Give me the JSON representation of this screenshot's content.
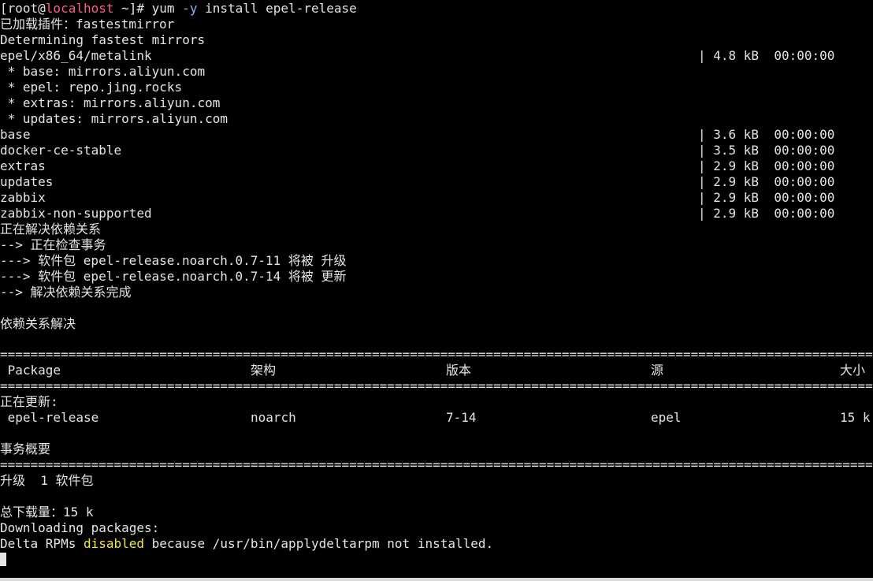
{
  "prompt": {
    "user": "[root@",
    "host": "localhost",
    "rest": " ~]# yum ",
    "flag": "-y",
    "command": " install epel-release"
  },
  "lines": {
    "l1": "已加载插件：fastestmirror",
    "l2": "Determining fastest mirrors",
    "l3": "epel/x86_64/metalink",
    "l3_right": "| 4.8 kB  00:00:00",
    "l4": " * base: mirrors.aliyun.com",
    "l5": " * epel: repo.jing.rocks",
    "l6": " * extras: mirrors.aliyun.com",
    "l7": " * updates: mirrors.aliyun.com"
  },
  "repos": [
    {
      "name": "base",
      "size": "| 3.6 kB  00:00:00"
    },
    {
      "name": "docker-ce-stable",
      "size": "| 3.5 kB  00:00:00"
    },
    {
      "name": "extras",
      "size": "| 2.9 kB  00:00:00"
    },
    {
      "name": "updates",
      "size": "| 2.9 kB  00:00:00"
    },
    {
      "name": "zabbix",
      "size": "| 2.9 kB  00:00:00"
    },
    {
      "name": "zabbix-non-supported",
      "size": "| 2.9 kB  00:00:00"
    }
  ],
  "resolve": {
    "r1": "正在解决依赖关系",
    "r2": "--> 正在检查事务",
    "r3": "---> 软件包 epel-release.noarch.0.7-11 将被 升级",
    "r4": "---> 软件包 epel-release.noarch.0.7-14 将被 更新",
    "r5": "--> 解决依赖关系完成",
    "r6": "依赖关系解决"
  },
  "table": {
    "rule": "============================================================================================================================================",
    "headers": {
      "package": " Package",
      "arch": "架构",
      "version": "版本",
      "repo": "源",
      "size": "大小"
    },
    "section": "正在更新:",
    "row": {
      "package": " epel-release",
      "arch": "noarch",
      "version": "7-14",
      "repo": "epel",
      "size": "15 k"
    }
  },
  "summary": {
    "title": "事务概要",
    "upgrade": "升级  1 软件包",
    "total": "总下载量：15 k",
    "downloading": "Downloading packages:",
    "delta_pre": "Delta RPMs ",
    "delta_word": "disabled",
    "delta_post": " because /usr/bin/applydeltarpm not installed."
  },
  "colors": {
    "background": "#000000",
    "text": "#e4e4e4",
    "host": "#ff5f87",
    "flag": "#8ab4ff",
    "highlight": "#f5e642"
  }
}
